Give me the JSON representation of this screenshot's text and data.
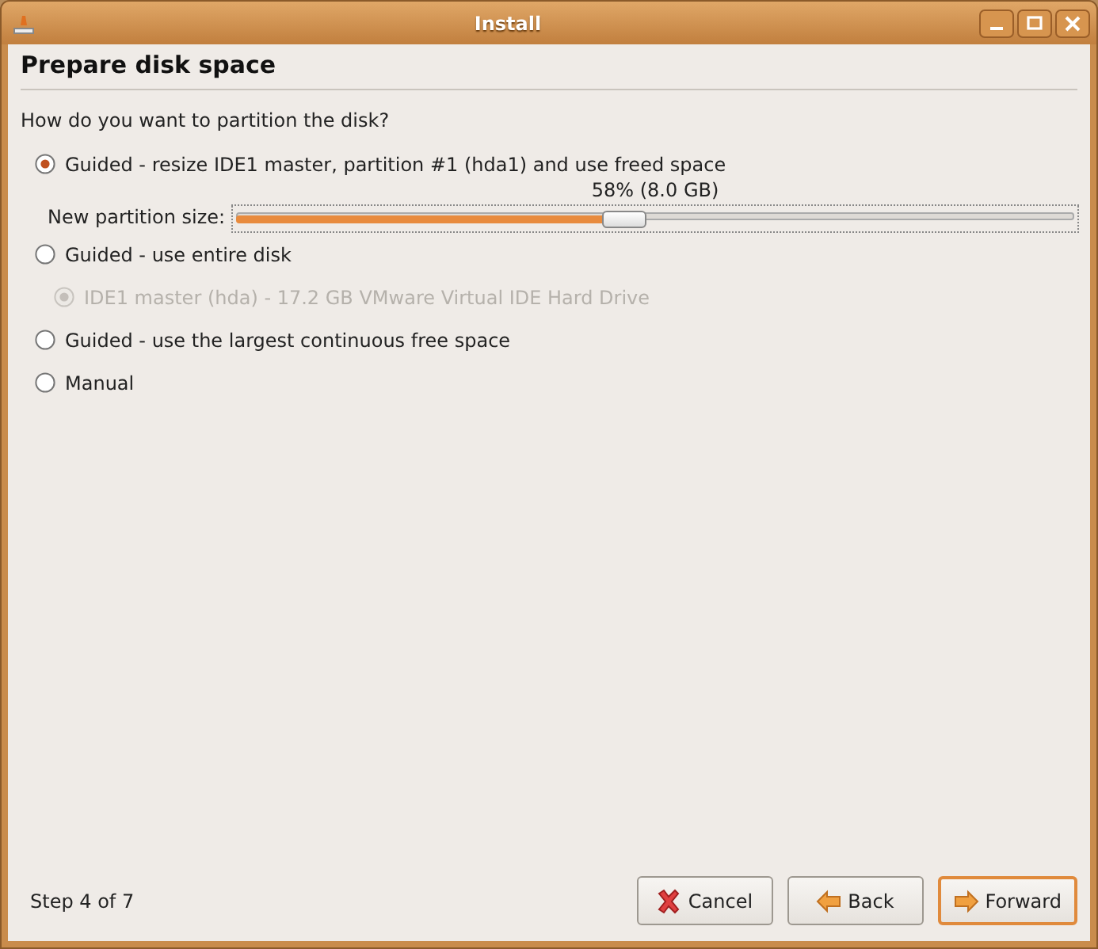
{
  "window": {
    "title": "Install"
  },
  "heading": "Prepare disk space",
  "question": "How do you want to partition the disk?",
  "options": [
    {
      "label": "Guided - resize IDE1 master, partition #1 (hda1) and use freed space",
      "selected": true,
      "slider": {
        "label": "New partition size:",
        "reading": "58% (8.0 GB)",
        "level": 0.46
      }
    },
    {
      "label": "Guided - use entire disk",
      "selected": false,
      "children": [
        {
          "label": "IDE1 master (hda) - 17.2 GB VMware Virtual IDE Hard Drive",
          "selected": true,
          "disabled": true
        }
      ]
    },
    {
      "label": "Guided - use the largest continuous free space",
      "selected": false
    },
    {
      "label": "Manual",
      "selected": false
    }
  ],
  "status": "Step 4 of 7",
  "buttons": [
    {
      "kind": "cancel",
      "label": "Cancel"
    },
    {
      "kind": "back",
      "label": "Back"
    },
    {
      "kind": "forward",
      "label": "Forward",
      "focused": true
    }
  ]
}
